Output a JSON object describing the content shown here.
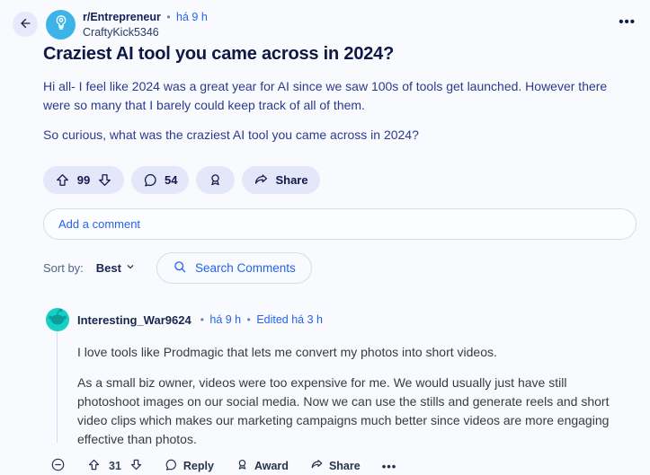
{
  "misc": {
    "dot": "•"
  },
  "colors": {
    "accent_blue": "#2563eb",
    "pill_bg": "#e4e7fa",
    "subreddit_avatar_bg": "#3cb4e8",
    "comment_avatar_bg": "#16d0c4",
    "title_navy": "#0f1844",
    "body_navy": "#2b3a8e",
    "page_bg": "#f8fafd"
  },
  "header": {
    "subreddit": "r/Entrepreneur",
    "post_time": "há 9 h",
    "author": "CraftyKick5346",
    "more": "•••"
  },
  "post": {
    "title": "Craziest AI tool you came across in 2024?",
    "body_p1": "Hi all- I feel like 2024 was a great year for AI since we saw 100s of tools get launched. However there were so many that I barely could keep track of all of them.",
    "body_p2": "So curious, what was the craziest AI tool you came across in 2024?",
    "upvotes": "99",
    "comment_count": "54",
    "share_label": "Share"
  },
  "comment_box": {
    "placeholder": "Add a comment"
  },
  "sort": {
    "label": "Sort by:",
    "value": "Best",
    "search_label": "Search Comments"
  },
  "comment": {
    "author": "Interesting_War9624",
    "time": "há 9 h",
    "edited": "Edited há 3 h",
    "body_p1": "I love tools like Prodmagic that lets me convert my photos into short videos.",
    "body_p2": "As a small biz owner, videos were too expensive for me. We would usually just have still photoshoot images on our social media. Now we can use the stills and generate reels and short video clips which makes our marketing campaigns much better since videos are more engaging effective than photos.",
    "votes": "31",
    "reply_label": "Reply",
    "award_label": "Award",
    "share_label": "Share",
    "more": "•••"
  }
}
